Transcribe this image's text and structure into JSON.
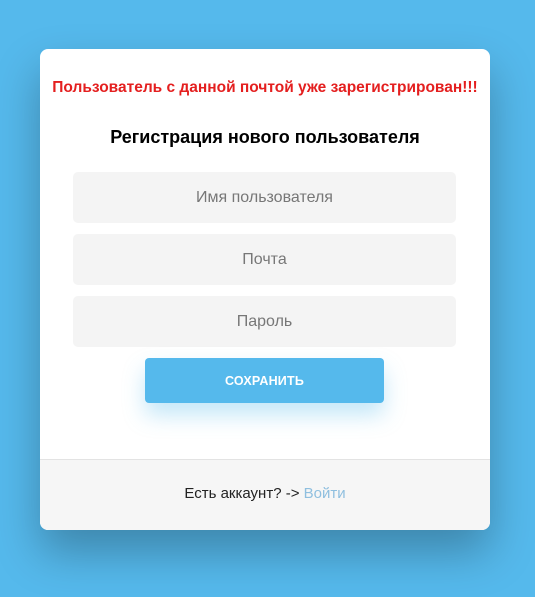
{
  "error_message": "Пользователь с данной почтой уже зарегистрирован!!!",
  "form": {
    "title": "Регистрация нового пользователя",
    "username_placeholder": "Имя пользователя",
    "email_placeholder": "Почта",
    "password_placeholder": "Пароль",
    "save_label": "СОХРАНИТЬ"
  },
  "footer": {
    "prompt": "Есть аккаунт? ->",
    "login_label": "Войти"
  },
  "colors": {
    "background": "#55b9ec",
    "accent": "#55b9ec",
    "error": "#e41f1f",
    "link": "#8fbfdf"
  }
}
